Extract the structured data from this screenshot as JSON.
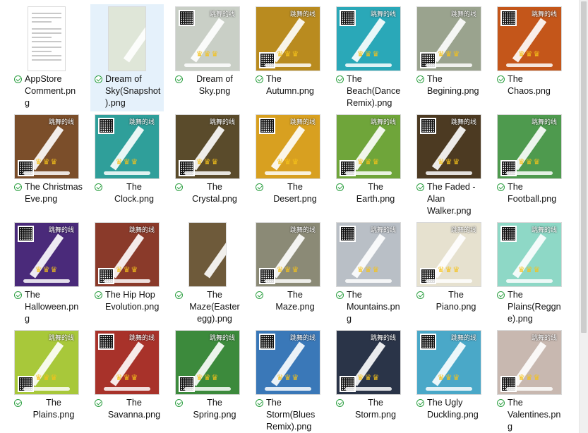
{
  "files": [
    {
      "label": "AppStore\nComment.pn\ng",
      "style": "doc",
      "bg": "#ffffff",
      "selected": false,
      "centered": false
    },
    {
      "label": "Dream of\nSky(Snapshot\n).png",
      "style": "narrow",
      "bg": "#dfe6d8",
      "selected": true,
      "centered": false
    },
    {
      "label": "Dream of\nSky.png",
      "style": "game",
      "bg": "#c9cfc6",
      "selected": false,
      "centered": true
    },
    {
      "label": "The\nAutumn.png",
      "style": "game",
      "bg": "#b98b1f",
      "selected": false,
      "centered": false
    },
    {
      "label": "The\nBeach(Dance\nRemix).png",
      "style": "game",
      "bg": "#2aa8b8",
      "selected": false,
      "centered": false
    },
    {
      "label": "The\nBegining.png",
      "style": "game",
      "bg": "#9aa38e",
      "selected": false,
      "centered": false
    },
    {
      "label": "The\nChaos.png",
      "style": "game",
      "bg": "#c4561a",
      "selected": false,
      "centered": false
    },
    {
      "label": "The Christmas\nEve.png",
      "style": "game",
      "bg": "#7b4e2a",
      "selected": false,
      "centered": false
    },
    {
      "label": "The\nClock.png",
      "style": "game",
      "bg": "#2f9f9a",
      "selected": false,
      "centered": true
    },
    {
      "label": "The\nCrystal.png",
      "style": "game",
      "bg": "#5a4b2b",
      "selected": false,
      "centered": true
    },
    {
      "label": "The\nDesert.png",
      "style": "game",
      "bg": "#d8a020",
      "selected": false,
      "centered": true
    },
    {
      "label": "The\nEarth.png",
      "style": "game",
      "bg": "#6fa53a",
      "selected": false,
      "centered": true
    },
    {
      "label": "The Faded -\nAlan\nWalker.png",
      "style": "game",
      "bg": "#4c3a22",
      "selected": false,
      "centered": false
    },
    {
      "label": "The\nFootball.png",
      "style": "game",
      "bg": "#4e9a4e",
      "selected": false,
      "centered": false
    },
    {
      "label": "The\nHalloween.pn\ng",
      "style": "game",
      "bg": "#4a2a7a",
      "selected": false,
      "centered": false
    },
    {
      "label": "The Hip Hop\nEvolution.png",
      "style": "game",
      "bg": "#8a3a2a",
      "selected": false,
      "centered": false
    },
    {
      "label": "The\nMaze(Easter\negg).png",
      "style": "narrow",
      "bg": "#6e5a3a",
      "selected": false,
      "centered": true
    },
    {
      "label": "The\nMaze.png",
      "style": "game",
      "bg": "#8b8a76",
      "selected": false,
      "centered": true
    },
    {
      "label": "The\nMountains.pn\ng",
      "style": "game",
      "bg": "#b9bfc6",
      "selected": false,
      "centered": false
    },
    {
      "label": "The\nPiano.png",
      "style": "game",
      "bg": "#e6e1cf",
      "selected": false,
      "centered": true
    },
    {
      "label": "The\nPlains(Reggn\ne).png",
      "style": "game",
      "bg": "#8ed8c6",
      "selected": false,
      "centered": false
    },
    {
      "label": "The\nPlains.png",
      "style": "game",
      "bg": "#a8c83a",
      "selected": false,
      "centered": true
    },
    {
      "label": "The\nSavanna.png",
      "style": "game",
      "bg": "#a8322a",
      "selected": false,
      "centered": true
    },
    {
      "label": "The\nSpring.png",
      "style": "game",
      "bg": "#3c8a3c",
      "selected": false,
      "centered": true
    },
    {
      "label": "The\nStorm(Blues\nRemix).png",
      "style": "game",
      "bg": "#3a78b8",
      "selected": false,
      "centered": false
    },
    {
      "label": "The\nStorm.png",
      "style": "game",
      "bg": "#2a3448",
      "selected": false,
      "centered": true
    },
    {
      "label": "The Ugly\nDuckling.png",
      "style": "game",
      "bg": "#4aa8c8",
      "selected": false,
      "centered": false
    },
    {
      "label": "The\nValentines.pn\ng",
      "style": "game",
      "bg": "#c8b8b0",
      "selected": false,
      "centered": false
    }
  ],
  "thumb_text": {
    "game_title": "跳舞的线",
    "crowns": "♛♛♛",
    "percent": "100%"
  },
  "status_icon": "sync-ok-check-icon",
  "icons": [
    "qr-code-icon",
    "crown-icon"
  ]
}
